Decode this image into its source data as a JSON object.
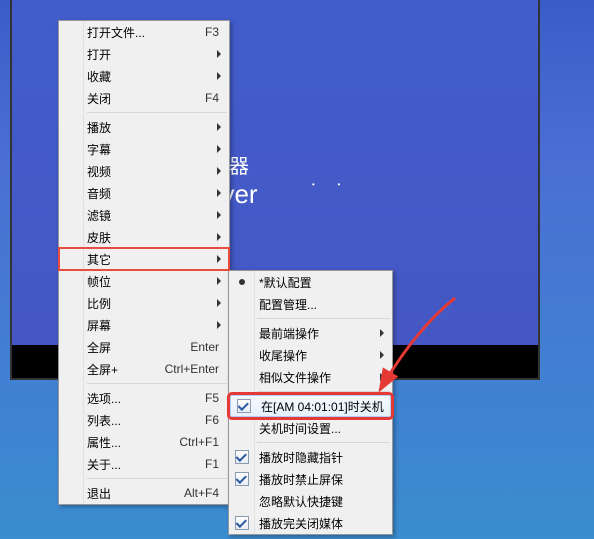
{
  "player": {
    "title_line1": "放器",
    "title_line2": "ayer"
  },
  "menu": {
    "open_file": "打开文件...",
    "open_file_key": "F3",
    "open": "打开",
    "favorites": "收藏",
    "close": "关闭",
    "close_key": "F4",
    "play": "播放",
    "subtitle": "字幕",
    "video": "视频",
    "audio": "音频",
    "filter": "滤镜",
    "skin": "皮肤",
    "other": "其它",
    "frame_pos": "帧位",
    "ratio": "比例",
    "screen": "屏幕",
    "fullscreen": "全屏",
    "fullscreen_key": "Enter",
    "fullscreen_plus": "全屏+",
    "fullscreen_plus_key": "Ctrl+Enter",
    "options": "选项...",
    "options_key": "F5",
    "playlist": "列表...",
    "playlist_key": "F6",
    "properties": "属性...",
    "properties_key": "Ctrl+F1",
    "about": "关于...",
    "about_key": "F1",
    "exit": "退出",
    "exit_key": "Alt+F4"
  },
  "submenu": {
    "default_config": "*默认配置",
    "config_manage": "配置管理...",
    "topmost": "最前端操作",
    "ending": "收尾操作",
    "similar_files": "相似文件操作",
    "shutdown_at": "在[AM 04:01:01]时关机",
    "shutdown_time_settings": "关机时间设置...",
    "hide_pointer": "播放时隐藏指针",
    "disable_screensaver": "播放时禁止屏保",
    "ignore_default_shortcut": "忽略默认快捷键",
    "close_media_on_end": "播放完关闭媒体"
  }
}
